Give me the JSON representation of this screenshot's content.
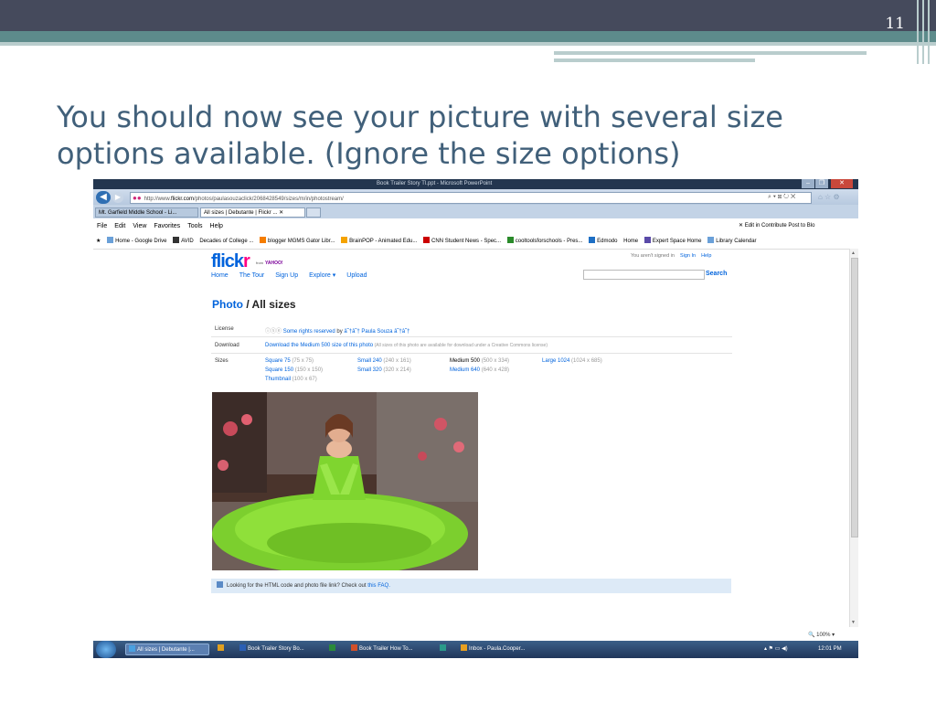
{
  "slide": {
    "number": "11",
    "title": "You should now see your picture with several size options available. (Ignore the size options)"
  },
  "window": {
    "title": "Book Trailer Story Tl.ppt - Microsoft PowerPoint",
    "min": "–",
    "max": "❐",
    "close": "✕"
  },
  "browser": {
    "url_prefix": "http://www.",
    "url_domain": "flickr.com",
    "url_path": "/photos/paulasouzaclick/2068428549/sizes/m/in/photostream/",
    "nav_icons": "⌕ ▾ ⊠ ↻ ✕",
    "right_icons": "⌂ ☆ ⚙",
    "tabs": [
      {
        "label": "Mt. Garfield Middle School - Li..."
      },
      {
        "label": "All sizes | Debutante | Flickr ... ✕"
      }
    ],
    "menu": [
      "File",
      "Edit",
      "View",
      "Favorites",
      "Tools",
      "Help"
    ],
    "menu_right": "✕   Edit in Contribute   Post to Blo",
    "favorites": [
      "Home - Google Drive",
      "AVID",
      "Decades of College ...",
      "blogger MGMS Gator Libr...",
      "BrainPOP - Animated Edu...",
      "CNN Student News - Spec...",
      "cooltoolsforschools - Pres...",
      "Edmodo",
      "Home",
      "Expert Space Home",
      "Library Calendar"
    ]
  },
  "flickr": {
    "logo": "flickr",
    "from": "from",
    "yahoo": "YAHOO!",
    "nav": [
      "Home",
      "The Tour",
      "Sign Up",
      "Explore ▾",
      "Upload"
    ],
    "signed_out": "You aren't signed in",
    "sign_in": "Sign In",
    "help": "Help",
    "search_button": "Search",
    "heading_link": "Photo",
    "heading_rest": " / All sizes",
    "license_label": "License",
    "license_icons": "ⓘⓢⓔ",
    "license_link": "Some rights reserved",
    "license_by": " by ",
    "license_author": "â˜†â˜† Paula Souza â˜†â˜†",
    "download_label": "Download",
    "download_link": "Download the Medium 500 size of this photo",
    "download_note": " (All sizes of this photo are available for download under a Creative Commons license)",
    "sizes_label": "Sizes",
    "sizes": [
      {
        "name": "Square 75",
        "dim": " (75 x 75)"
      },
      {
        "name": "Square 150",
        "dim": " (150 x 150)"
      },
      {
        "name": "Thumbnail",
        "dim": " (100 x 67)"
      },
      {
        "name": "Small 240",
        "dim": " (240 x 161)"
      },
      {
        "name": "Small 320",
        "dim": " (320 x 214)"
      },
      {
        "name": "Medium 500",
        "dim": " (500 x 334)"
      },
      {
        "name": "Medium 640",
        "dim": " (640 x 428)"
      },
      {
        "name": "Large 1024",
        "dim": " (1024 x 685)"
      }
    ],
    "faq_text": "Looking for the HTML code and photo file link? Check out ",
    "faq_link": "this FAQ."
  },
  "status": {
    "zoom": "🔍 100%  ▾"
  },
  "taskbar": {
    "items": [
      {
        "label": "All sizes | Debutante |..."
      },
      {
        "label": ""
      },
      {
        "label": "Book Trailer Story Bo..."
      },
      {
        "label": ""
      },
      {
        "label": "Book Trailer How To..."
      },
      {
        "label": ""
      },
      {
        "label": "Inbox - Paula.Cooper..."
      }
    ],
    "tray": "▴  ⚑  ▭  ◀)",
    "clock": "12:01 PM"
  },
  "colors": {
    "slide_bar": "#454a5c",
    "accent_teal": "#5d8b8b",
    "title_text": "#41607a",
    "flickr_blue": "#0063dc",
    "flickr_pink": "#ff0084"
  }
}
